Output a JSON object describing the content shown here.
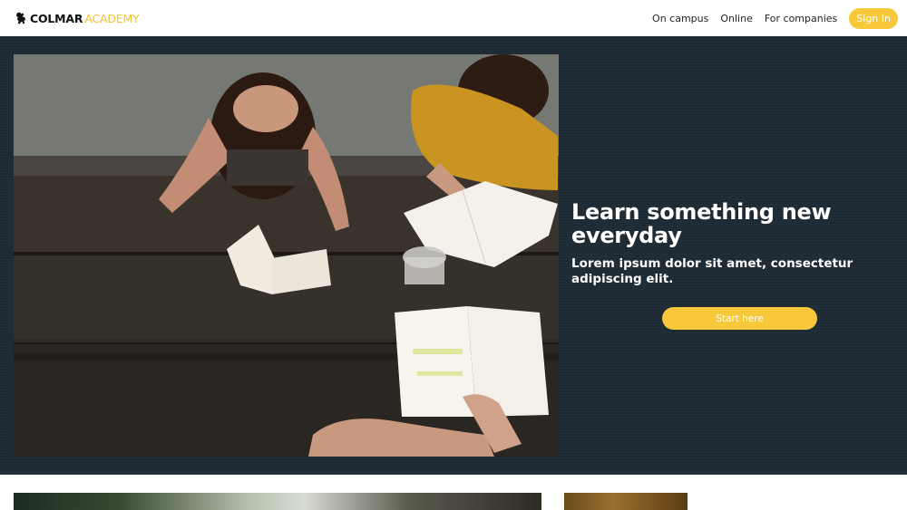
{
  "header": {
    "logo_part1": "COLMAR",
    "logo_part2": "ACADEMY",
    "logo_icon": "lion-icon",
    "nav": [
      {
        "label": "On campus"
      },
      {
        "label": "Online"
      },
      {
        "label": "For companies"
      }
    ],
    "signin_label": "Sign In"
  },
  "hero": {
    "title": "Learn something new everyday",
    "subtitle": "Lorem ipsum dolor sit amet, consectetur adipiscing elit.",
    "cta_label": "Start here"
  },
  "colors": {
    "accent": "#f7c93a",
    "hero_bg": "#1e2b34",
    "logo_accent": "#f2c230"
  }
}
